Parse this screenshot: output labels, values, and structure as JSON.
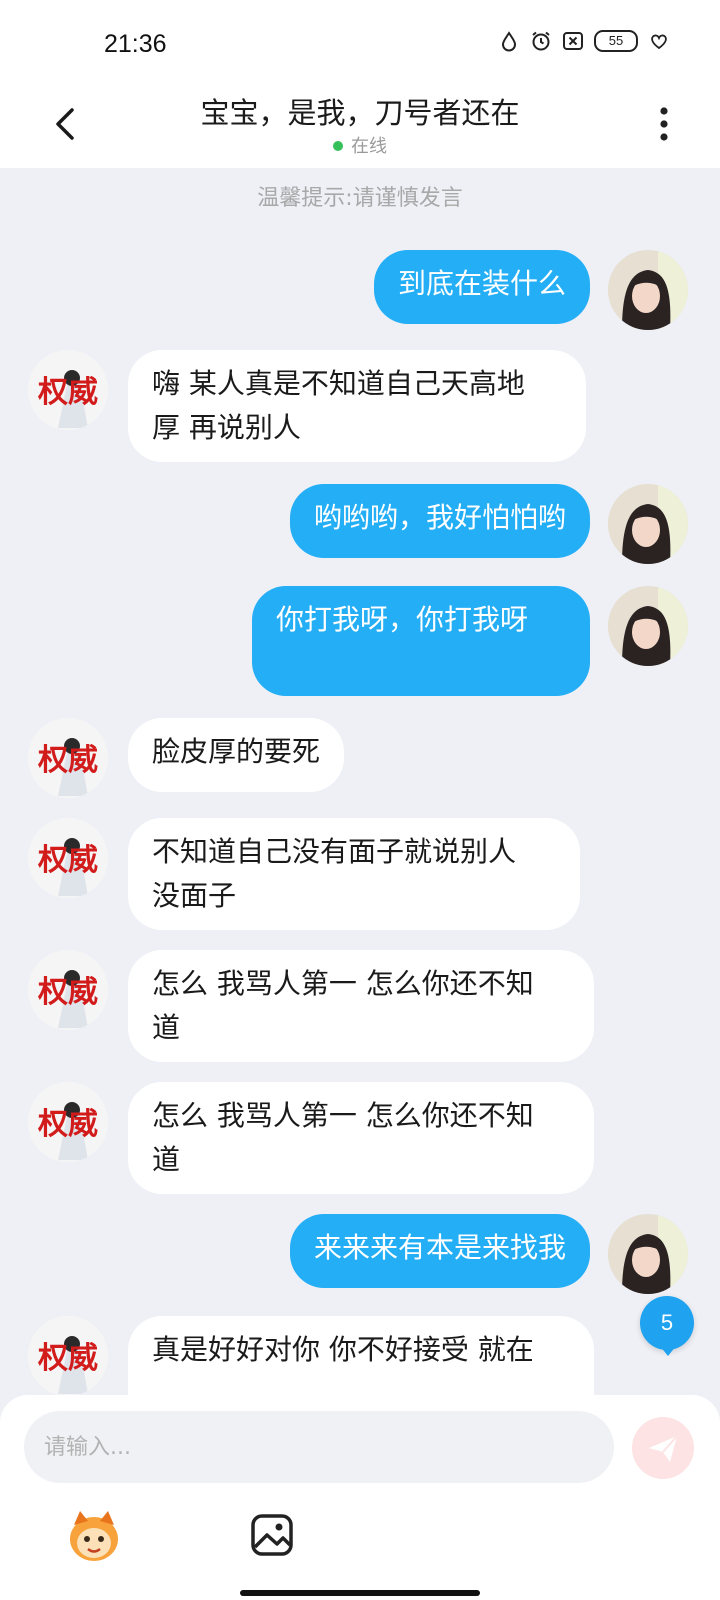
{
  "status_bar": {
    "time": "21:36",
    "battery": "55",
    "icons": [
      "drop-icon",
      "alarm-icon",
      "close-box-icon",
      "heart-wings-icon"
    ]
  },
  "header": {
    "title": "宝宝，是我，刀号者还在",
    "status": "在线",
    "status_color": "#36c05a"
  },
  "chat": {
    "tip": "温馨提示:请谨慎发言",
    "messages": [
      {
        "from": "me",
        "lines": [
          "到底在装什么"
        ]
      },
      {
        "from": "other",
        "lines": [
          "嗨 某人真是不知道自己天高地",
          "厚 再说别人"
        ]
      },
      {
        "from": "me",
        "lines": [
          "哟哟哟，我好怕怕哟"
        ]
      },
      {
        "from": "me",
        "lines": [
          "你打我呀，你打我呀",
          ""
        ]
      },
      {
        "from": "other",
        "lines": [
          "脸皮厚的要死"
        ]
      },
      {
        "from": "other",
        "lines": [
          "不知道自己没有面子就说别人",
          "没面子"
        ]
      },
      {
        "from": "other",
        "lines": [
          "怎么 我骂人第一 怎么你还不知",
          "道"
        ]
      },
      {
        "from": "other",
        "lines": [
          "怎么 我骂人第一 怎么你还不知",
          "道"
        ]
      },
      {
        "from": "me",
        "lines": [
          "来来来有本是来找我"
        ]
      },
      {
        "from": "other",
        "lines": [
          "真是好好对你 你不好接受 就在"
        ]
      }
    ],
    "new_count": "5",
    "other_avatar_text": "权威"
  },
  "composer": {
    "placeholder": "请输入..."
  },
  "colors": {
    "my_bubble": "#23aef5",
    "other_bubble": "#ffffff",
    "background": "#eef0f6",
    "accent_red": "#d21c1c"
  }
}
